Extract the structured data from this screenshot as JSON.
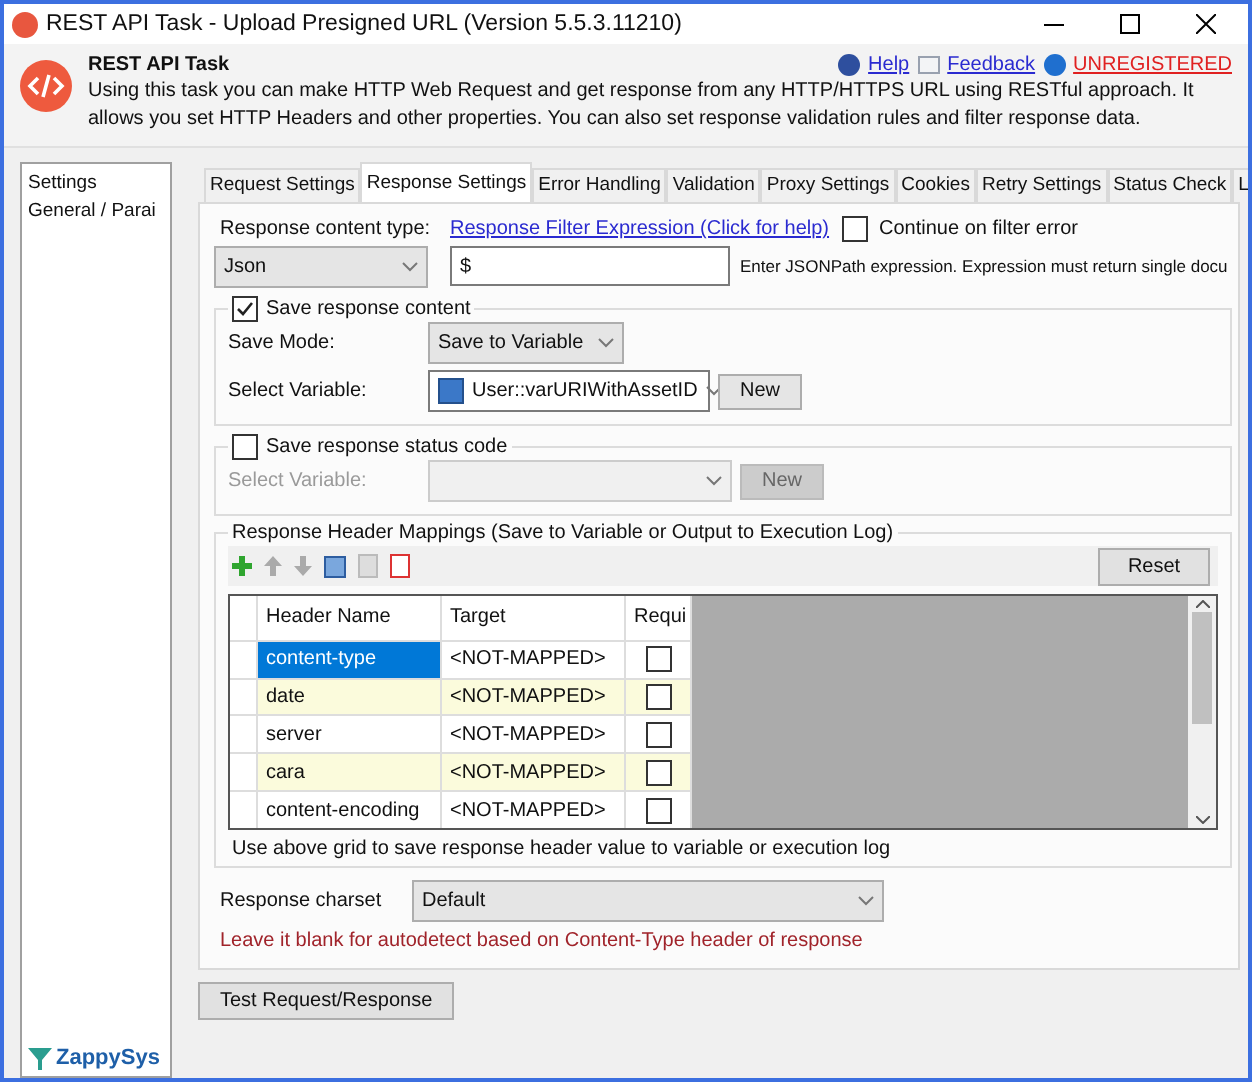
{
  "window": {
    "title": "REST API Task - Upload Presigned URL (Version 5.5.3.11210)"
  },
  "header": {
    "title": "REST API Task",
    "description": "Using this task you can make HTTP Web Request and get response from any HTTP/HTTPS URL using RESTful approach. It allows you set HTTP Headers and other properties. You can also set response validation rules and filter response data.",
    "links": [
      {
        "label": "Help",
        "kind": "help"
      },
      {
        "label": "Feedback",
        "kind": "feedback"
      },
      {
        "label": "UNREGISTERED",
        "kind": "warning"
      }
    ]
  },
  "sidebar": {
    "items": [
      "Settings",
      "General / Parai"
    ]
  },
  "tabs": [
    {
      "label": "Request Settings",
      "selected": false
    },
    {
      "label": "Response Settings",
      "selected": true
    },
    {
      "label": "Error Handling",
      "selected": false
    },
    {
      "label": "Validation",
      "selected": false
    },
    {
      "label": "Proxy Settings",
      "selected": false
    },
    {
      "label": "Cookies",
      "selected": false
    },
    {
      "label": "Retry Settings",
      "selected": false
    },
    {
      "label": "Status Check",
      "selected": false
    },
    {
      "label": "L",
      "selected": false
    }
  ],
  "content_type": {
    "label": "Response content type:",
    "value": "Json"
  },
  "filter": {
    "link": "Response Filter Expression (Click for help)",
    "value": "$",
    "hint": "Enter JSONPath expression. Expression must return single docu",
    "continue_label": "Continue on filter error",
    "continue_checked": false
  },
  "save_content": {
    "label": "Save response content",
    "checked": true,
    "save_mode_label": "Save Mode:",
    "save_mode": "Save to Variable",
    "variable_label": "Select Variable:",
    "variable": "User::varURIWithAssetID",
    "new_button": "New"
  },
  "save_status": {
    "label": "Save response status code",
    "checked": false,
    "variable_label": "Select Variable:",
    "new_button": "New"
  },
  "mappings": {
    "title": "Response Header Mappings (Save to Variable or Output to Execution Log)",
    "reset_button": "Reset",
    "columns": [
      "Header Name",
      "Target",
      "Requi"
    ],
    "rows": [
      {
        "name": "content-type",
        "target": "<NOT-MAPPED>",
        "required": false,
        "selected": true
      },
      {
        "name": "date",
        "target": "<NOT-MAPPED>",
        "required": false,
        "selected": false
      },
      {
        "name": "server",
        "target": "<NOT-MAPPED>",
        "required": false,
        "selected": false
      },
      {
        "name": "cara",
        "target": "<NOT-MAPPED>",
        "required": false,
        "selected": false
      },
      {
        "name": "content-encoding",
        "target": "<NOT-MAPPED>",
        "required": false,
        "selected": false
      }
    ],
    "footer": "Use above grid to save response header value to variable or execution log"
  },
  "charset": {
    "label": "Response charset",
    "value": "Default",
    "hint": "Leave it blank for autodetect based on Content-Type header of response"
  },
  "test_button": "Test Request/Response",
  "brand": "ZappySys"
}
